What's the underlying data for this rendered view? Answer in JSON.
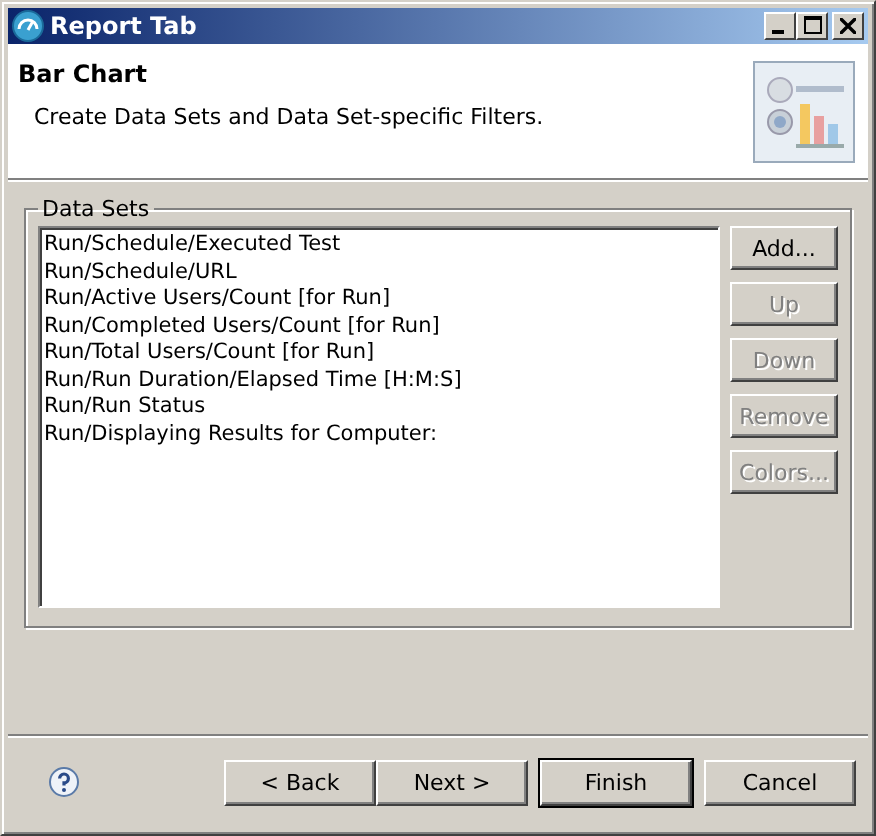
{
  "window": {
    "title": "Report Tab"
  },
  "header": {
    "title": "Bar Chart",
    "description": "Create Data Sets and Data Set-specific Filters."
  },
  "data_sets": {
    "label": "Data Sets",
    "items": [
      "Run/Schedule/Executed Test",
      "Run/Schedule/URL",
      "Run/Active Users/Count [for Run]",
      "Run/Completed Users/Count [for Run]",
      "Run/Total Users/Count [for Run]",
      "Run/Run Duration/Elapsed Time [H:M:S]",
      "Run/Run Status",
      "Run/Displaying Results for Computer:"
    ],
    "buttons": [
      {
        "label": "Add...",
        "disabled": false
      },
      {
        "label": "Up",
        "disabled": true
      },
      {
        "label": "Down",
        "disabled": true
      },
      {
        "label": "Remove",
        "disabled": true
      },
      {
        "label": "Colors...",
        "disabled": true
      }
    ]
  },
  "footer_buttons": [
    {
      "label": "< Back",
      "default": false
    },
    {
      "label": "Next >",
      "default": false
    },
    {
      "label": "Finish",
      "default": true
    },
    {
      "label": "Cancel",
      "default": false
    }
  ]
}
